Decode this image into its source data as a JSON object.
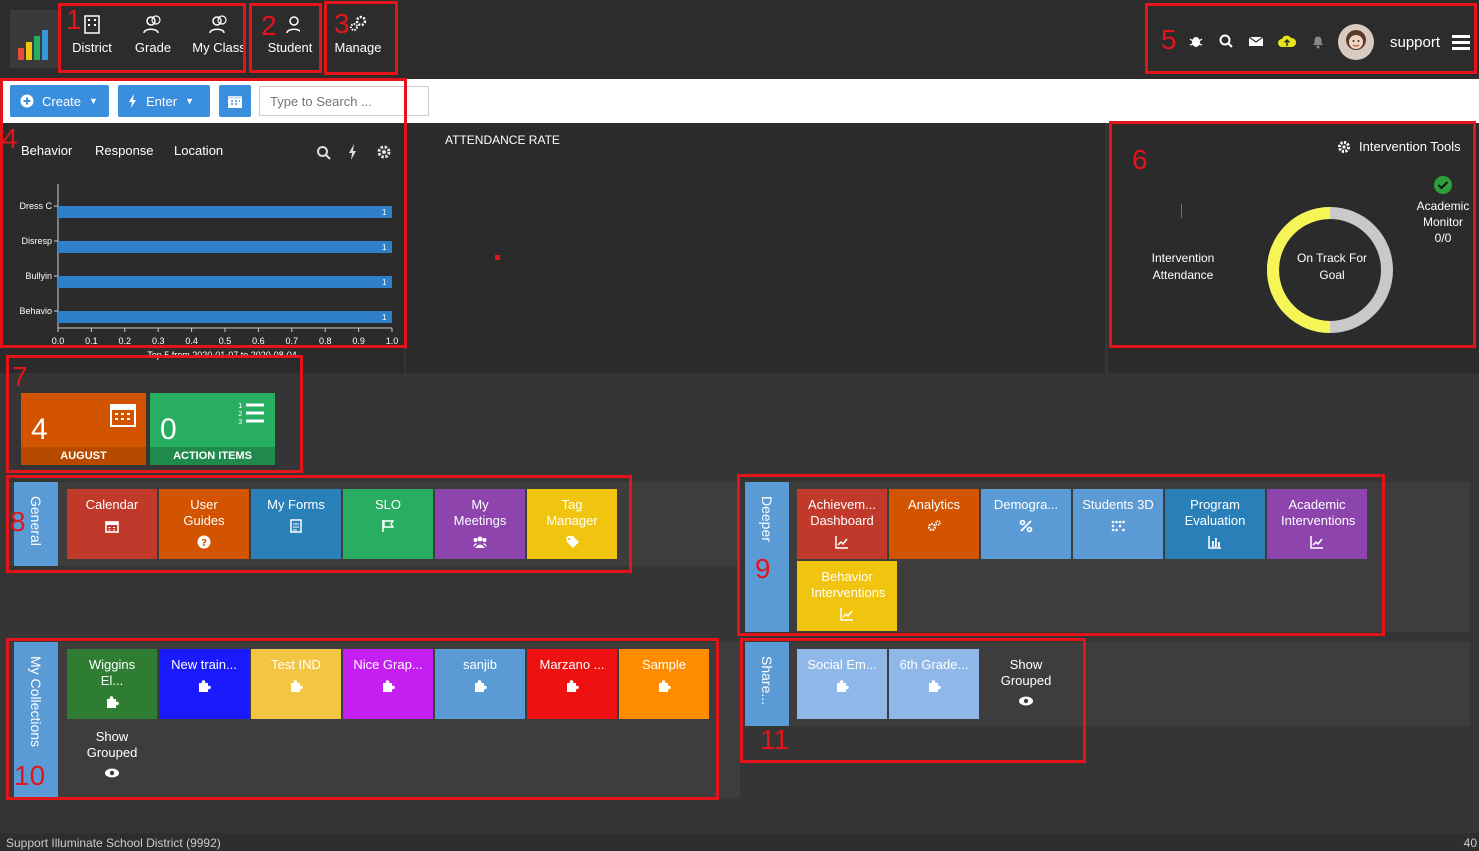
{
  "nav": {
    "items": [
      {
        "label": "District",
        "icon": "building-icon"
      },
      {
        "label": "Grade",
        "icon": "users-icon"
      },
      {
        "label": "My Class",
        "icon": "users-icon"
      },
      {
        "label": "Student",
        "icon": "user-icon"
      },
      {
        "label": "Manage",
        "icon": "gears-icon"
      }
    ],
    "username": "support"
  },
  "toolbar": {
    "create_label": "Create",
    "enter_label": "Enter",
    "search_placeholder": "Type to Search ..."
  },
  "behavior_panel": {
    "tabs": [
      "Behavior",
      "Response",
      "Location"
    ],
    "caption": "Top 5 from 2020-01-07 to 2020-08-04"
  },
  "chart_data": {
    "type": "bar",
    "orientation": "horizontal",
    "categories": [
      "Dress C",
      "Disresp",
      "Bullyin",
      "Behavio"
    ],
    "values": [
      1,
      1,
      1,
      1
    ],
    "data_labels": [
      "1",
      "1",
      "1",
      "1"
    ],
    "xlim": [
      0,
      1
    ],
    "xticks": [
      "0.0",
      "0.1",
      "0.2",
      "0.3",
      "0.4",
      "0.5",
      "0.6",
      "0.7",
      "0.8",
      "0.9",
      "1.0"
    ],
    "bar_color": "#2f80c8",
    "title": ""
  },
  "attendance": {
    "title": "ATTENDANCE RATE"
  },
  "intervention": {
    "tools_label": "Intervention Tools",
    "attendance_label": "Intervention Attendance",
    "goal_label": "On Track For Goal",
    "monitor_label": "Academic Monitor",
    "monitor_value": "0/0",
    "goal_ring_fraction": 0.5
  },
  "stats": [
    {
      "value": "4",
      "caption": "AUGUST",
      "color": "#d35400",
      "icon": "calendar-icon"
    },
    {
      "value": "0",
      "caption": "ACTION ITEMS",
      "color": "#27ae60",
      "icon": "list-icon"
    }
  ],
  "general": {
    "label": "General",
    "tiles": [
      {
        "label": "Calendar",
        "color": "#c0392b",
        "icon": "calendar-icon"
      },
      {
        "label": "User Guides",
        "color": "#d35400",
        "icon": "question-icon"
      },
      {
        "label": "My Forms",
        "color": "#2980b9",
        "icon": "form-icon"
      },
      {
        "label": "SLO",
        "color": "#27ae60",
        "icon": "flag-icon"
      },
      {
        "label": "My Meetings",
        "color": "#8e44ad",
        "icon": "group-icon"
      },
      {
        "label": "Tag Manager",
        "color": "#f1c40f",
        "icon": "tag-icon"
      }
    ]
  },
  "deeper": {
    "label": "Deeper",
    "tiles": [
      {
        "label": "Achievem... Dashboard",
        "color": "#c0392b",
        "icon": "chart-icon"
      },
      {
        "label": "Analytics",
        "color": "#d35400",
        "icon": "gears-icon"
      },
      {
        "label": "Demogra...",
        "color": "#5b9bd5",
        "icon": "percent-icon"
      },
      {
        "label": "Students 3D",
        "color": "#5b9bd5",
        "icon": "dots-icon"
      },
      {
        "label": "Program Evaluation",
        "color": "#2980b9",
        "icon": "bar-icon"
      },
      {
        "label": "Academic Interventions",
        "color": "#8e44ad",
        "icon": "chart-icon"
      },
      {
        "label": "Behavior Interventions",
        "color": "#f1c40f",
        "icon": "chart-icon"
      }
    ]
  },
  "collections": {
    "label": "My Collections",
    "tiles": [
      {
        "label": "Wiggins El...",
        "color": "#2e7d32",
        "icon": "puzzle-icon"
      },
      {
        "label": "New train...",
        "color": "#1a1aff",
        "icon": "puzzle-icon"
      },
      {
        "label": "Test IND",
        "color": "#f4c542",
        "icon": "puzzle-icon"
      },
      {
        "label": "Nice Grap...",
        "color": "#c41ef0",
        "icon": "puzzle-icon"
      },
      {
        "label": "sanjib",
        "color": "#5b9bd5",
        "icon": "puzzle-icon"
      },
      {
        "label": "Marzano ...",
        "color": "#ee1111",
        "icon": "puzzle-icon"
      },
      {
        "label": "Sample",
        "color": "#ff8c00",
        "icon": "puzzle-icon"
      }
    ],
    "show_grouped": "Show Grouped"
  },
  "shared": {
    "label": "Share...",
    "tiles": [
      {
        "label": "Social Em...",
        "color": "#8fb8e8",
        "icon": "puzzle-icon"
      },
      {
        "label": "6th Grade...",
        "color": "#8fb8e8",
        "icon": "puzzle-icon"
      }
    ],
    "show_grouped": "Show Grouped"
  },
  "footer": {
    "text": "Support Illuminate School District (9992)",
    "right": "40"
  },
  "annotations": [
    "1",
    "2",
    "3",
    "4",
    "5",
    "6",
    "7",
    "8",
    "9",
    "10",
    "11"
  ]
}
